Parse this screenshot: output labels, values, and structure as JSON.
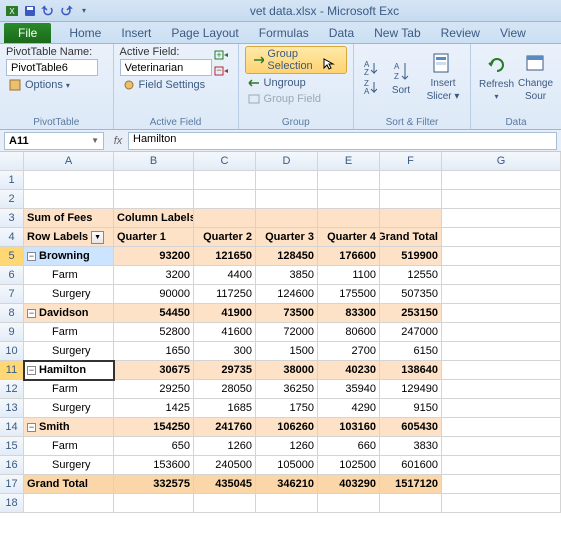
{
  "titlebar": {
    "title": "vet data.xlsx - Microsoft Exc"
  },
  "tabs": {
    "file": "File",
    "home": "Home",
    "insert": "Insert",
    "pagelayout": "Page Layout",
    "formulas": "Formulas",
    "data": "Data",
    "newtab": "New Tab",
    "review": "Review",
    "view": "View"
  },
  "ribbon": {
    "pivottable": {
      "name_lbl": "PivotTable Name:",
      "name_val": "PivotTable6",
      "options": "Options",
      "group": "PivotTable"
    },
    "activefield": {
      "lbl": "Active Field:",
      "val": "Veterinarian",
      "settings": "Field Settings",
      "group": "Active Field"
    },
    "group": {
      "selection": "Group Selection",
      "ungroup": "Ungroup",
      "field": "Group Field",
      "group": "Group"
    },
    "sortfilter": {
      "sort": "Sort",
      "slicer_l1": "Insert",
      "slicer_l2": "Slicer",
      "group": "Sort & Filter"
    },
    "data": {
      "refresh": "Refresh",
      "change_l1": "Change",
      "change_l2": "Sour",
      "group": "Data"
    }
  },
  "fbar": {
    "name": "A11",
    "value": "Hamilton"
  },
  "cols": [
    "A",
    "B",
    "C",
    "D",
    "E",
    "F",
    "G"
  ],
  "hdr": {
    "sumfees": "Sum of Fees",
    "collabels": "Column Labels",
    "rowlabels": "Row Labels",
    "q1": "Quarter 1",
    "q2": "Quarter 2",
    "q3": "Quarter 3",
    "q4": "Quarter 4",
    "gt": "Grand Total"
  },
  "chart_data": {
    "type": "table",
    "title": "Sum of Fees",
    "columns": [
      "Quarter 1",
      "Quarter 2",
      "Quarter 3",
      "Quarter 4",
      "Grand Total"
    ],
    "rows": [
      {
        "name": "Browning",
        "values": [
          93200,
          121650,
          128450,
          176600,
          519900
        ],
        "children": [
          {
            "name": "Farm",
            "values": [
              3200,
              4400,
              3850,
              1100,
              12550
            ]
          },
          {
            "name": "Surgery",
            "values": [
              90000,
              117250,
              124600,
              175500,
              507350
            ]
          }
        ]
      },
      {
        "name": "Davidson",
        "values": [
          54450,
          41900,
          73500,
          83300,
          253150
        ],
        "children": [
          {
            "name": "Farm",
            "values": [
              52800,
              41600,
              72000,
              80600,
              247000
            ]
          },
          {
            "name": "Surgery",
            "values": [
              1650,
              300,
              1500,
              2700,
              6150
            ]
          }
        ]
      },
      {
        "name": "Hamilton",
        "values": [
          30675,
          29735,
          38000,
          40230,
          138640
        ],
        "children": [
          {
            "name": "Farm",
            "values": [
              29250,
              28050,
              36250,
              35940,
              129490
            ]
          },
          {
            "name": "Surgery",
            "values": [
              1425,
              1685,
              1750,
              4290,
              9150
            ]
          }
        ]
      },
      {
        "name": "Smith",
        "values": [
          154250,
          241760,
          106260,
          103160,
          605430
        ],
        "children": [
          {
            "name": "Farm",
            "values": [
              650,
              1260,
              1260,
              660,
              3830
            ]
          },
          {
            "name": "Surgery",
            "values": [
              153600,
              240500,
              105000,
              102500,
              601600
            ]
          }
        ]
      }
    ],
    "grand_total": [
      332575,
      435045,
      346210,
      403290,
      1517120
    ]
  },
  "rows": {
    "r5": {
      "name": "Browning",
      "v": [
        "93200",
        "121650",
        "128450",
        "176600",
        "519900"
      ]
    },
    "r6": {
      "name": "Farm",
      "v": [
        "3200",
        "4400",
        "3850",
        "1100",
        "12550"
      ]
    },
    "r7": {
      "name": "Surgery",
      "v": [
        "90000",
        "117250",
        "124600",
        "175500",
        "507350"
      ]
    },
    "r8": {
      "name": "Davidson",
      "v": [
        "54450",
        "41900",
        "73500",
        "83300",
        "253150"
      ]
    },
    "r9": {
      "name": "Farm",
      "v": [
        "52800",
        "41600",
        "72000",
        "80600",
        "247000"
      ]
    },
    "r10": {
      "name": "Surgery",
      "v": [
        "1650",
        "300",
        "1500",
        "2700",
        "6150"
      ]
    },
    "r11": {
      "name": "Hamilton",
      "v": [
        "30675",
        "29735",
        "38000",
        "40230",
        "138640"
      ]
    },
    "r12": {
      "name": "Farm",
      "v": [
        "29250",
        "28050",
        "36250",
        "35940",
        "129490"
      ]
    },
    "r13": {
      "name": "Surgery",
      "v": [
        "1425",
        "1685",
        "1750",
        "4290",
        "9150"
      ]
    },
    "r14": {
      "name": "Smith",
      "v": [
        "154250",
        "241760",
        "106260",
        "103160",
        "605430"
      ]
    },
    "r15": {
      "name": "Farm",
      "v": [
        "650",
        "1260",
        "1260",
        "660",
        "3830"
      ]
    },
    "r16": {
      "name": "Surgery",
      "v": [
        "153600",
        "240500",
        "105000",
        "102500",
        "601600"
      ]
    },
    "r17": {
      "name": "Grand Total",
      "v": [
        "332575",
        "435045",
        "346210",
        "403290",
        "1517120"
      ]
    }
  }
}
